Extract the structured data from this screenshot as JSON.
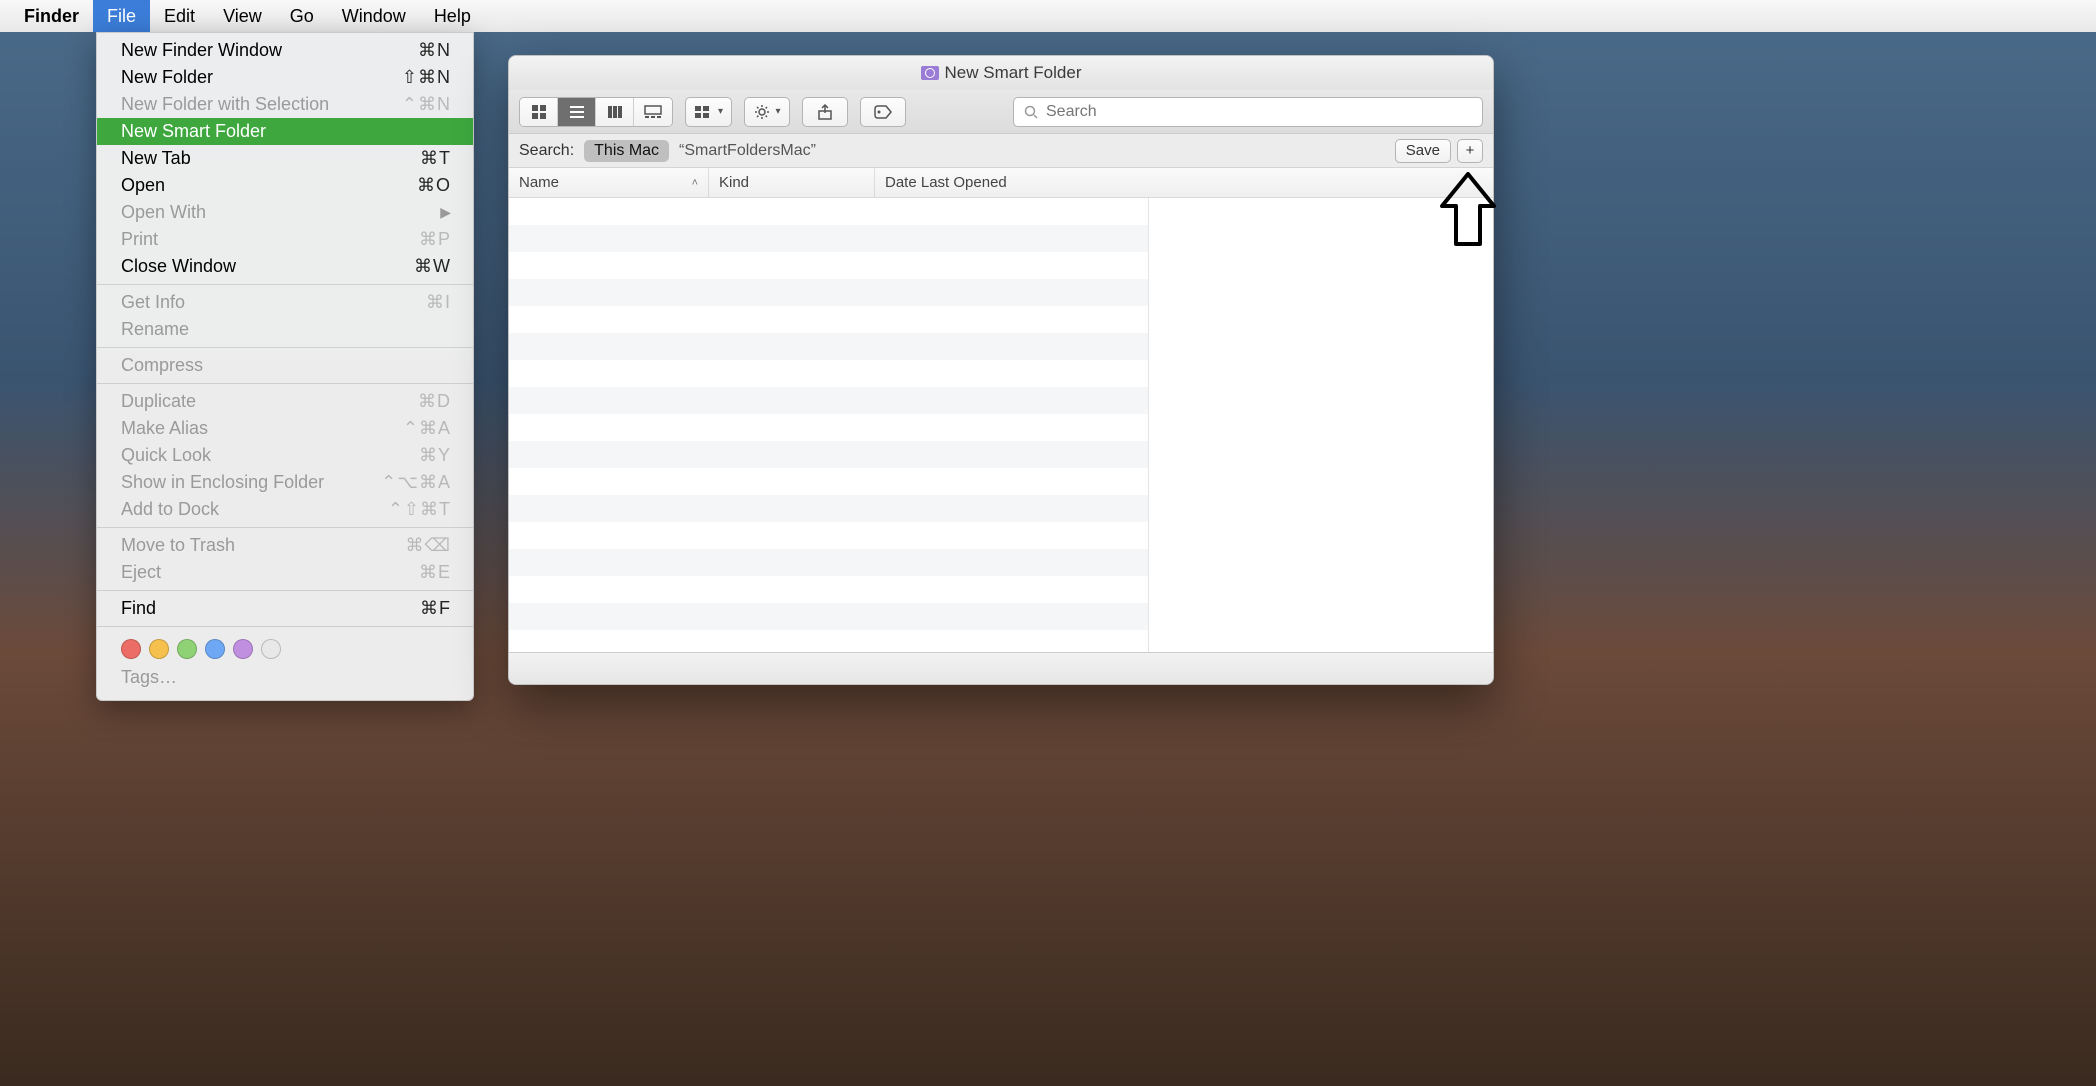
{
  "menubar": {
    "app": "Finder",
    "items": [
      "File",
      "Edit",
      "View",
      "Go",
      "Window",
      "Help"
    ],
    "open_index": 0
  },
  "file_menu": {
    "groups": [
      [
        {
          "label": "New Finder Window",
          "shortcut": "⌘N",
          "enabled": true
        },
        {
          "label": "New Folder",
          "shortcut": "⇧⌘N",
          "enabled": true
        },
        {
          "label": "New Folder with Selection",
          "shortcut": "⌃⌘N",
          "enabled": false
        },
        {
          "label": "New Smart Folder",
          "shortcut": "",
          "enabled": true,
          "highlight": true
        },
        {
          "label": "New Tab",
          "shortcut": "⌘T",
          "enabled": true
        },
        {
          "label": "Open",
          "shortcut": "⌘O",
          "enabled": true
        },
        {
          "label": "Open With",
          "shortcut": "",
          "enabled": false,
          "submenu": true
        },
        {
          "label": "Print",
          "shortcut": "⌘P",
          "enabled": false
        },
        {
          "label": "Close Window",
          "shortcut": "⌘W",
          "enabled": true
        }
      ],
      [
        {
          "label": "Get Info",
          "shortcut": "⌘I",
          "enabled": false
        },
        {
          "label": "Rename",
          "shortcut": "",
          "enabled": false
        }
      ],
      [
        {
          "label": "Compress",
          "shortcut": "",
          "enabled": false
        }
      ],
      [
        {
          "label": "Duplicate",
          "shortcut": "⌘D",
          "enabled": false
        },
        {
          "label": "Make Alias",
          "shortcut": "⌃⌘A",
          "enabled": false
        },
        {
          "label": "Quick Look",
          "shortcut": "⌘Y",
          "enabled": false
        },
        {
          "label": "Show in Enclosing Folder",
          "shortcut": "⌃⌥⌘A",
          "enabled": false
        },
        {
          "label": "Add to Dock",
          "shortcut": "⌃⇧⌘T",
          "enabled": false
        }
      ],
      [
        {
          "label": "Move to Trash",
          "shortcut": "⌘⌫",
          "enabled": false
        },
        {
          "label": "Eject",
          "shortcut": "⌘E",
          "enabled": false
        }
      ],
      [
        {
          "label": "Find",
          "shortcut": "⌘F",
          "enabled": true
        }
      ]
    ],
    "tag_colors": [
      "#ec6d66",
      "#f5c04e",
      "#8fd276",
      "#6ea8f5",
      "#c08fe0",
      "#b8b8b8"
    ],
    "tags_label": "Tags…"
  },
  "window": {
    "title": "New Smart Folder",
    "toolbar": {
      "view_mode_active": 1,
      "arrange_label": "",
      "search_placeholder": "Search"
    },
    "scopebar": {
      "prefix": "Search:",
      "scope_selected": "This Mac",
      "scope_location": "“SmartFoldersMac”",
      "save_label": "Save",
      "add_label": "+"
    },
    "columns": {
      "name": "Name",
      "kind": "Kind",
      "date": "Date Last Opened"
    }
  }
}
